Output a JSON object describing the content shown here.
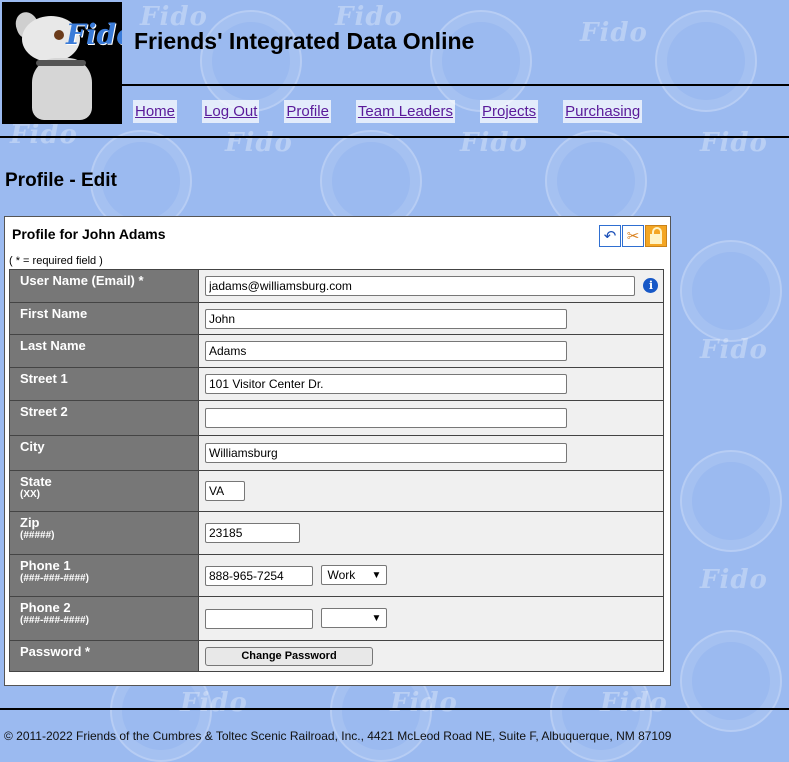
{
  "logo_text": "Fido",
  "site_title": "Friends' Integrated Data Online",
  "nav": [
    "Home",
    "Log Out",
    "Profile",
    "Team Leaders",
    "Projects",
    "Purchasing"
  ],
  "page_heading": "Profile - Edit",
  "panel": {
    "title": "Profile for John Adams",
    "required_note": "( * = required field )",
    "tools": [
      "undo-icon",
      "wrench-icon",
      "lock-icon"
    ]
  },
  "fields": {
    "email": {
      "label": "User Name (Email) *",
      "value": "jadams@williamsburg.com"
    },
    "first_name": {
      "label": "First Name",
      "value": "John"
    },
    "last_name": {
      "label": "Last Name",
      "value": "Adams"
    },
    "street1": {
      "label": "Street 1",
      "value": "101 Visitor Center Dr."
    },
    "street2": {
      "label": "Street 2",
      "value": ""
    },
    "city": {
      "label": "City",
      "value": "Williamsburg"
    },
    "state": {
      "label": "State",
      "hint": "(XX)",
      "value": "VA"
    },
    "zip": {
      "label": "Zip",
      "hint": "(#####)",
      "value": "23185"
    },
    "phone1": {
      "label": "Phone 1",
      "hint": "(###-###-####)",
      "value": "888-965-7254",
      "type": "Work"
    },
    "phone2": {
      "label": "Phone 2",
      "hint": "(###-###-####)",
      "value": "",
      "type": ""
    },
    "password": {
      "label": "Password *",
      "button": "Change Password"
    }
  },
  "footer": "© 2011-2022 Friends of the Cumbres & Toltec Scenic Railroad, Inc., 4421 McLeod Road NE, Suite F, Albuquerque, NM 87109",
  "colors": {
    "background": "#9bbaf0",
    "label_bg": "#777777",
    "value_bg": "#f0f0f0",
    "link": "#5a1a9a",
    "info": "#1758c7"
  }
}
